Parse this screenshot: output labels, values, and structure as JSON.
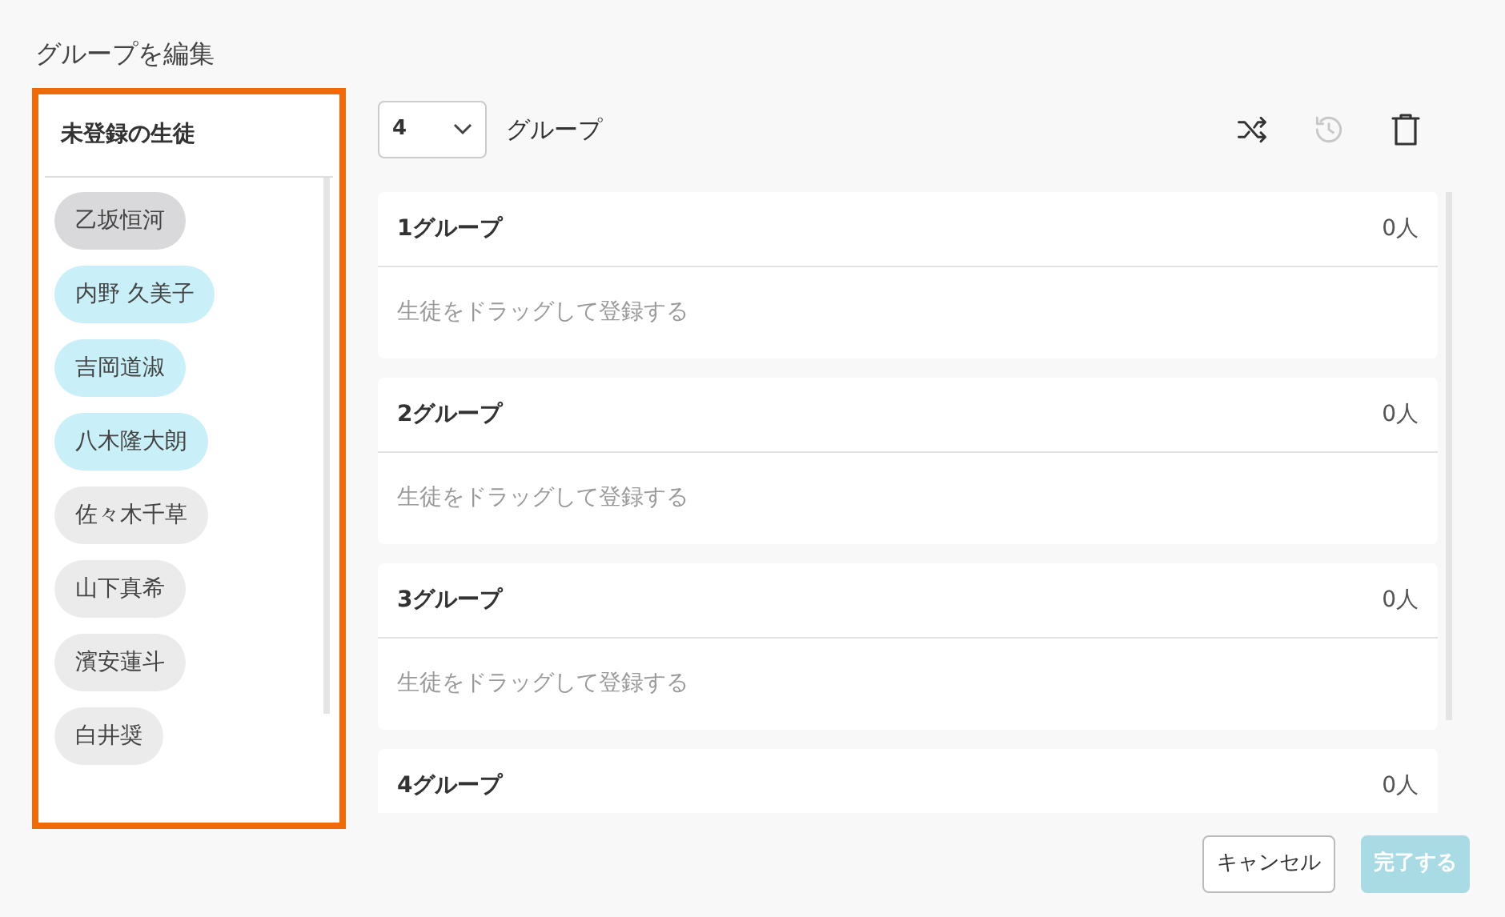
{
  "title": "グループを編集",
  "unregistered": {
    "heading": "未登録の生徒",
    "highlighted": true,
    "students": [
      {
        "name": "乙坂恒河",
        "color": "#d9d9db"
      },
      {
        "name": "内野 久美子",
        "color": "#c9f0f8"
      },
      {
        "name": "吉岡道淑",
        "color": "#c9f0f8"
      },
      {
        "name": "八木隆大朗",
        "color": "#c9f0f8"
      },
      {
        "name": "佐々木千草",
        "color": "#ebebeb"
      },
      {
        "name": "山下真希",
        "color": "#ebebeb"
      },
      {
        "name": "濱安蓮斗",
        "color": "#ebebeb"
      },
      {
        "name": "白井奨",
        "color": "#ebebeb"
      }
    ]
  },
  "group_count": {
    "value": "4",
    "label": "グループ"
  },
  "toolbar": [
    {
      "kind": "shuffle",
      "disabled": false
    },
    {
      "kind": "history",
      "disabled": true
    },
    {
      "kind": "trash",
      "disabled": false
    }
  ],
  "groups": [
    {
      "name": "1グループ",
      "count": "0人",
      "placeholder": "生徒をドラッグして登録する"
    },
    {
      "name": "2グループ",
      "count": "0人",
      "placeholder": "生徒をドラッグして登録する"
    },
    {
      "name": "3グループ",
      "count": "0人",
      "placeholder": "生徒をドラッグして登録する"
    },
    {
      "name": "4グループ",
      "count": "0人"
    }
  ],
  "buttons": [
    {
      "label": "キャンセル",
      "disabled": false
    },
    {
      "label": "完了する",
      "disabled": true
    }
  ]
}
